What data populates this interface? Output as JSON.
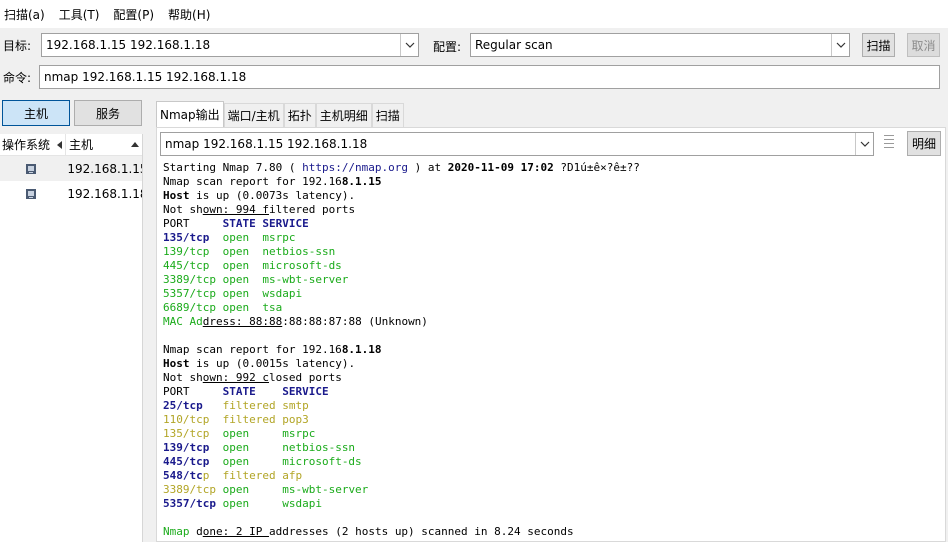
{
  "menu": [
    "扫描(a)",
    "工具(T)",
    "配置(P)",
    "帮助(H)"
  ],
  "target_label": "目标:",
  "target_value": "192.168.1.15 192.168.1.18",
  "profile_label": "配置:",
  "profile_value": "Regular scan",
  "scan_button": "扫描",
  "cancel_button": "取消",
  "command_label": "命令:",
  "command_value": "nmap 192.168.1.15 192.168.1.18",
  "left_tabs": [
    "主机",
    "服务"
  ],
  "host_columns": [
    "操作系统",
    "主机"
  ],
  "hosts": [
    "192.168.1.15",
    "192.168.1.18"
  ],
  "output_tabs": [
    "Nmap输出",
    "端口/主机",
    "拓扑",
    "主机明细",
    "扫描"
  ],
  "output_selector": "nmap 192.168.1.15 192.168.1.18",
  "detail_button": "明细",
  "colors": {
    "open": "#1bab1b",
    "filtered": "#b2a526",
    "port": "#1a1a8c",
    "active_tab": "#cce4f7"
  },
  "output": [
    [
      [
        "c-black",
        "Starting Nmap 7.80 ( "
      ],
      [
        "c-navy-n",
        "https://nmap.org"
      ],
      [
        "c-black",
        " ) at "
      ],
      [
        "c-bold",
        "2020-11-09 17:02"
      ],
      [
        "c-black",
        " ?D1ú±ê×?ê±??"
      ]
    ],
    [
      [
        "c-black",
        "Nmap scan report for 192.16"
      ],
      [
        "c-bold",
        "8.1.15"
      ]
    ],
    [
      [
        "c-bold",
        "Host"
      ],
      [
        "c-black",
        " is up (0.0073s latency)."
      ]
    ],
    [
      [
        "c-black",
        "Not sh"
      ],
      [
        "c-black c-ul",
        "own: 994 f"
      ],
      [
        "c-black",
        "iltered ports"
      ]
    ],
    [
      [
        "c-black",
        "PORT     "
      ],
      [
        "c-navy",
        "STATE SERVICE"
      ]
    ],
    [
      [
        "c-navy",
        "135/tcp "
      ],
      [
        "c-green",
        " open  msrpc"
      ]
    ],
    [
      [
        "c-green",
        "139/tcp  open  netbios-ssn"
      ]
    ],
    [
      [
        "c-green",
        "445/tcp  open  microsoft-ds"
      ]
    ],
    [
      [
        "c-green",
        "3389/tcp open  ms-wbt-server"
      ]
    ],
    [
      [
        "c-green",
        "5357/tcp open  wsdapi"
      ]
    ],
    [
      [
        "c-green",
        "6689/tcp open  tsa"
      ]
    ],
    [
      [
        "c-green",
        "MAC Ad"
      ],
      [
        "c-black c-ul",
        "dress: 88:88"
      ],
      [
        "c-black",
        ":88:88:87:88 (Unknown)"
      ]
    ],
    [
      [
        "c-black",
        " "
      ]
    ],
    [
      [
        "c-black",
        "Nmap scan report for 192.16"
      ],
      [
        "c-bold",
        "8.1.18"
      ]
    ],
    [
      [
        "c-bold",
        "Host"
      ],
      [
        "c-black",
        " is up (0.0015s latency)."
      ]
    ],
    [
      [
        "c-black",
        "Not sh"
      ],
      [
        "c-black c-ul",
        "own: 992 c"
      ],
      [
        "c-black",
        "losed ports"
      ]
    ],
    [
      [
        "c-black",
        "PORT     "
      ],
      [
        "c-navy",
        "STATE    SERVICE"
      ]
    ],
    [
      [
        "c-navy",
        "25/tcp "
      ],
      [
        "c-olive",
        "  filtered smtp"
      ]
    ],
    [
      [
        "c-olive",
        "110/tcp  filtered pop3"
      ]
    ],
    [
      [
        "c-olive",
        "135/tcp "
      ],
      [
        "c-green",
        " open     msrpc"
      ]
    ],
    [
      [
        "c-navy",
        "139/tcp "
      ],
      [
        "c-green",
        " open     netbios-ssn"
      ]
    ],
    [
      [
        "c-navy",
        "445/tcp "
      ],
      [
        "c-green",
        " open     microsoft-ds"
      ]
    ],
    [
      [
        "c-navy",
        "548/tc"
      ],
      [
        "c-olive",
        "p  filtered afp"
      ]
    ],
    [
      [
        "c-olive",
        "3389/tcp "
      ],
      [
        "c-green",
        "open     ms-wbt-server"
      ]
    ],
    [
      [
        "c-navy",
        "5357/tcp "
      ],
      [
        "c-green",
        "open     wsdapi"
      ]
    ],
    [
      [
        "c-black",
        " "
      ]
    ],
    [
      [
        "c-green",
        "Nmap "
      ],
      [
        "c-black",
        "d"
      ],
      [
        "c-black c-ul",
        "one: 2 IP "
      ],
      [
        "c-black",
        "addresses (2 hosts up) scanned in 8.24 seconds"
      ]
    ]
  ]
}
